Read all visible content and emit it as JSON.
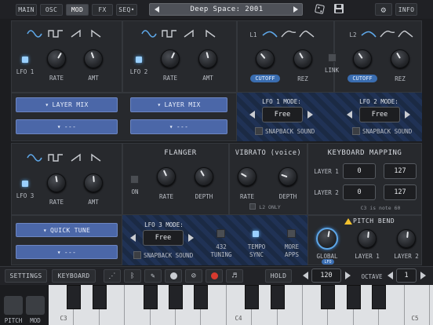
{
  "topbar": {
    "tabs": [
      "MAIN",
      "OSC",
      "MOD",
      "FX",
      "SEQ•"
    ],
    "active_tab": "MOD",
    "preset_name": "Deep Space: 2001",
    "info_label": "INFO"
  },
  "lfo1": {
    "led_label": "LFO 1",
    "rate_label": "RATE",
    "amt_label": "AMT",
    "dropdown1": "LAYER MIX",
    "dropdown2": "---"
  },
  "lfo2": {
    "led_label": "LFO 2",
    "rate_label": "RATE",
    "amt_label": "AMT",
    "dropdown1": "LAYER MIX",
    "dropdown2": "---"
  },
  "lfo3": {
    "led_label": "LFO 3",
    "rate_label": "RATE",
    "amt_label": "AMT",
    "dropdown1": "QUICK TUNE",
    "dropdown2": "---"
  },
  "filter_lfo": {
    "l1_label": "L1",
    "l2_label": "L2",
    "cutoff_label": "CUTOFF",
    "rez_label": "REZ",
    "link_label": "LINK"
  },
  "lfo_modes": {
    "lfo1_title": "LFO 1 MODE:",
    "lfo1_value": "Free",
    "lfo2_title": "LFO 2 MODE:",
    "lfo2_value": "Free",
    "lfo3_title": "LFO 3 MODE:",
    "lfo3_value": "Free",
    "snapback": "SNAPBACK SOUND"
  },
  "flanger": {
    "title": "FLANGER",
    "on_label": "ON",
    "rate_label": "RATE",
    "depth_label": "DEPTH"
  },
  "vibrato": {
    "title": "VIBRATO (voice)",
    "rate_label": "RATE",
    "depth_label": "DEPTH",
    "l2only": "L2 ONLY"
  },
  "keyboard_mapping": {
    "title": "KEYBOARD MAPPING",
    "layer1_label": "LAYER 1",
    "layer1_low": "0",
    "layer1_high": "127",
    "layer2_label": "LAYER 2",
    "layer2_low": "0",
    "layer2_high": "127",
    "note": "C3 is note 60"
  },
  "misc": {
    "tuning_value": "432",
    "tuning_label": "TUNING",
    "tempo_label": "TEMPO",
    "sync_label": "SYNC",
    "more_label": "MORE",
    "apps_label": "APPS"
  },
  "pitch_bend": {
    "title": "PITCH BEND",
    "global_label": "GLOBAL",
    "global_sub": "LFO",
    "layer1": "LAYER 1",
    "layer2": "LAYER 2"
  },
  "bottombar": {
    "settings": "SETTINGS",
    "keyboard": "KEYBOARD",
    "hold": "HOLD",
    "tempo_value": "120",
    "octave_label": "OCTAVE",
    "octave_value": "1"
  },
  "keys": {
    "c3": "C3",
    "c4": "C4",
    "c5": "C5",
    "pitch": "PITCH",
    "mod": "MOD"
  },
  "colors": {
    "accent_blue": "#5ea7e8",
    "dropdown_blue": "#4b67a8",
    "panel": "#27292d"
  }
}
